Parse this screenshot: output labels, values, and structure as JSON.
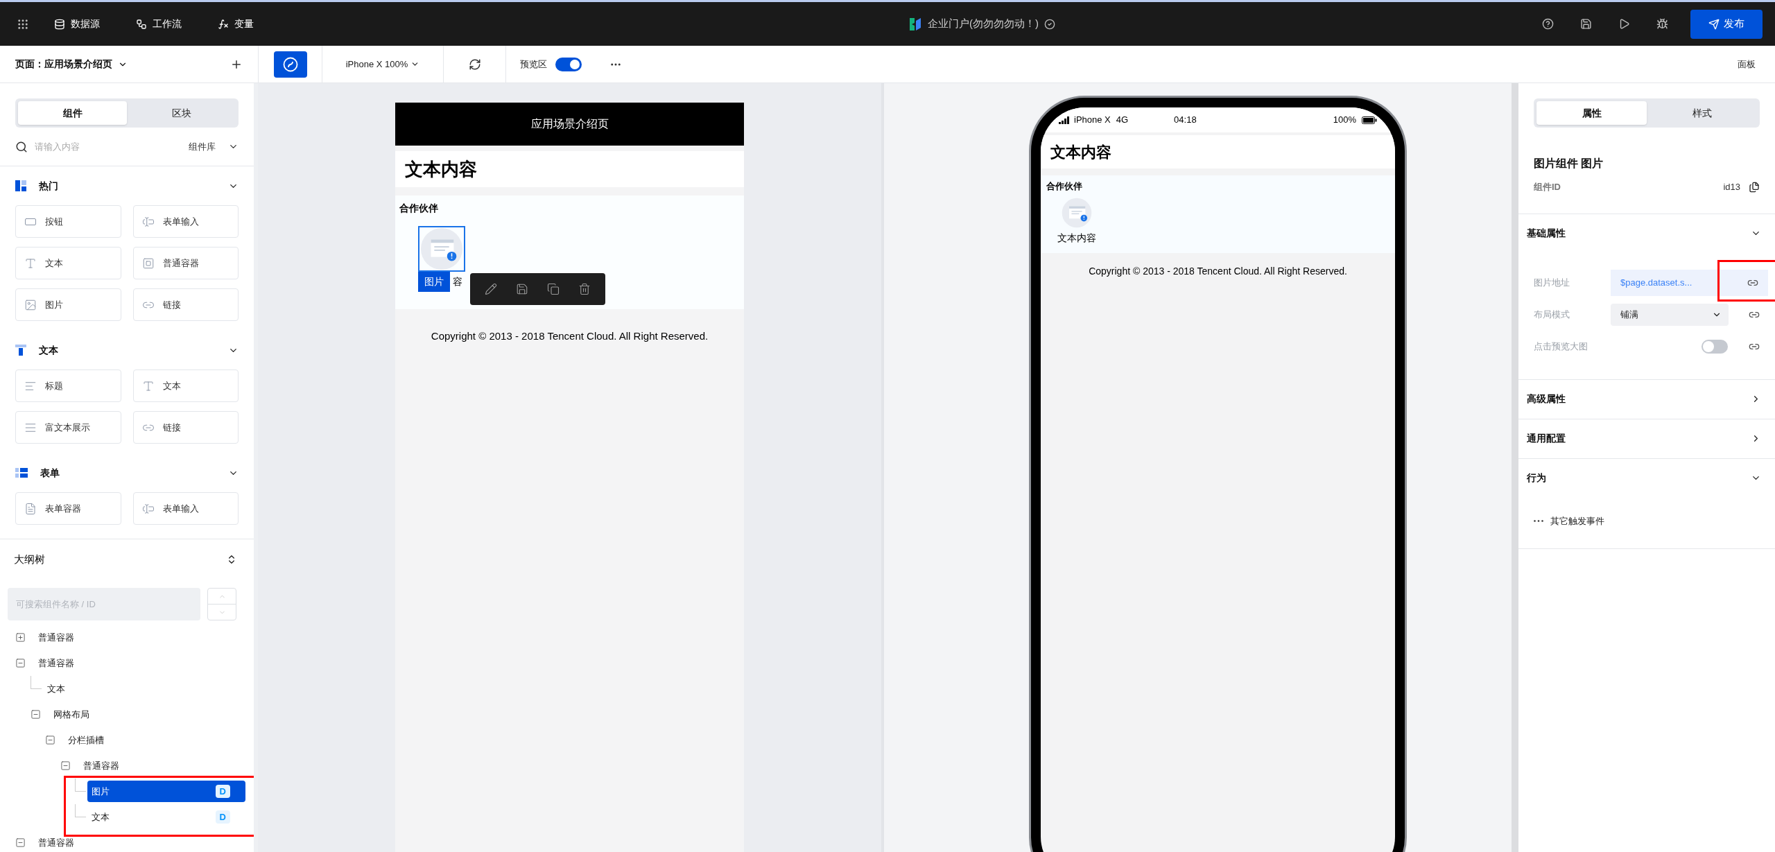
{
  "topbar": {
    "nav": [
      {
        "kind": "database",
        "label": "数据源"
      },
      {
        "kind": "workflow",
        "label": "工作流"
      },
      {
        "kind": "function",
        "label": "变量"
      }
    ],
    "title": "企业门户(勿勿勿勿动！)",
    "publish": "发布"
  },
  "toolbar": {
    "page_label": "页面：应用场景介绍页",
    "device": "iPhone X 100%",
    "preview_label": "预览区",
    "preview_on": true,
    "panel": "面板"
  },
  "library": {
    "tabs": [
      {
        "label": "组件",
        "selected": true
      },
      {
        "label": "区块",
        "selected": false
      }
    ],
    "search_placeholder": "请输入内容",
    "source": "组件库",
    "sections": [
      {
        "kind": "hot",
        "title": "热门",
        "expanded": true,
        "items": [
          {
            "kind": "button",
            "label": "按钮"
          },
          {
            "kind": "input",
            "label": "表单输入"
          },
          {
            "kind": "text",
            "label": "文本"
          },
          {
            "kind": "container",
            "label": "普通容器"
          },
          {
            "kind": "image",
            "label": "图片"
          },
          {
            "kind": "link",
            "label": "链接"
          }
        ]
      },
      {
        "kind": "text",
        "title": "文本",
        "expanded": true,
        "items": [
          {
            "kind": "heading",
            "label": "标题"
          },
          {
            "kind": "text",
            "label": "文本"
          },
          {
            "kind": "richtext",
            "label": "富文本展示"
          },
          {
            "kind": "link",
            "label": "链接"
          }
        ]
      },
      {
        "kind": "form",
        "title": "表单",
        "expanded": true,
        "items": [
          {
            "kind": "form",
            "label": "表单容器"
          },
          {
            "kind": "input",
            "label": "表单输入"
          }
        ]
      }
    ]
  },
  "outline": {
    "title": "大纲树",
    "search_placeholder": "可搜索组件名称 / ID",
    "tree": [
      {
        "label": "普通容器",
        "expanded": false,
        "selected": false
      },
      {
        "label": "普通容器",
        "expanded": true,
        "selected": false,
        "children": [
          {
            "label": "文本",
            "selected": false
          },
          {
            "label": "网格布局",
            "expanded": true,
            "selected": false,
            "children": [
              {
                "label": "分栏插槽",
                "expanded": true,
                "selected": false,
                "children": [
                  {
                    "label": "普通容器",
                    "expanded": true,
                    "selected": false,
                    "highlighted": true,
                    "children": [
                      {
                        "label": "图片",
                        "selected": true,
                        "badge": "D"
                      },
                      {
                        "label": "文本",
                        "selected": false,
                        "badge": "D"
                      }
                    ]
                  }
                ]
              }
            ]
          }
        ]
      },
      {
        "label": "普通容器",
        "expanded": true,
        "selected": false
      }
    ]
  },
  "canvas": {
    "header": "应用场景介绍页",
    "heading": "文本内容",
    "section_title": "合作伙伴",
    "selected_tag": "图片",
    "caption": "容",
    "footer": "Copyright © 2013 - 2018 Tencent Cloud. All Right Reserved."
  },
  "phone": {
    "carrier": "iPhone X",
    "network": "4G",
    "time": "04:18",
    "battery": "100%",
    "heading": "文本内容",
    "section_title": "合作伙伴",
    "caption": "文本内容",
    "footer": "Copyright © 2013 - 2018 Tencent Cloud. All Right Reserved."
  },
  "properties": {
    "tabs": [
      {
        "label": "属性",
        "selected": true
      },
      {
        "label": "样式",
        "selected": false
      }
    ],
    "title": "图片组件 图片",
    "id_label": "组件ID",
    "id": "id13",
    "sections": [
      {
        "title": "基础属性",
        "expanded": true,
        "fields": [
          {
            "kind": "binding",
            "label": "图片地址",
            "value": "$page.dataset.s...",
            "highlighted": true
          },
          {
            "kind": "select",
            "label": "布局模式",
            "value": "铺满"
          },
          {
            "kind": "switch",
            "label": "点击预览大图",
            "on": false
          }
        ]
      },
      {
        "title": "高级属性",
        "expanded": false
      },
      {
        "title": "通用配置",
        "expanded": false
      },
      {
        "title": "行为",
        "expanded": true,
        "events": [
          "其它触发事件"
        ]
      }
    ]
  }
}
